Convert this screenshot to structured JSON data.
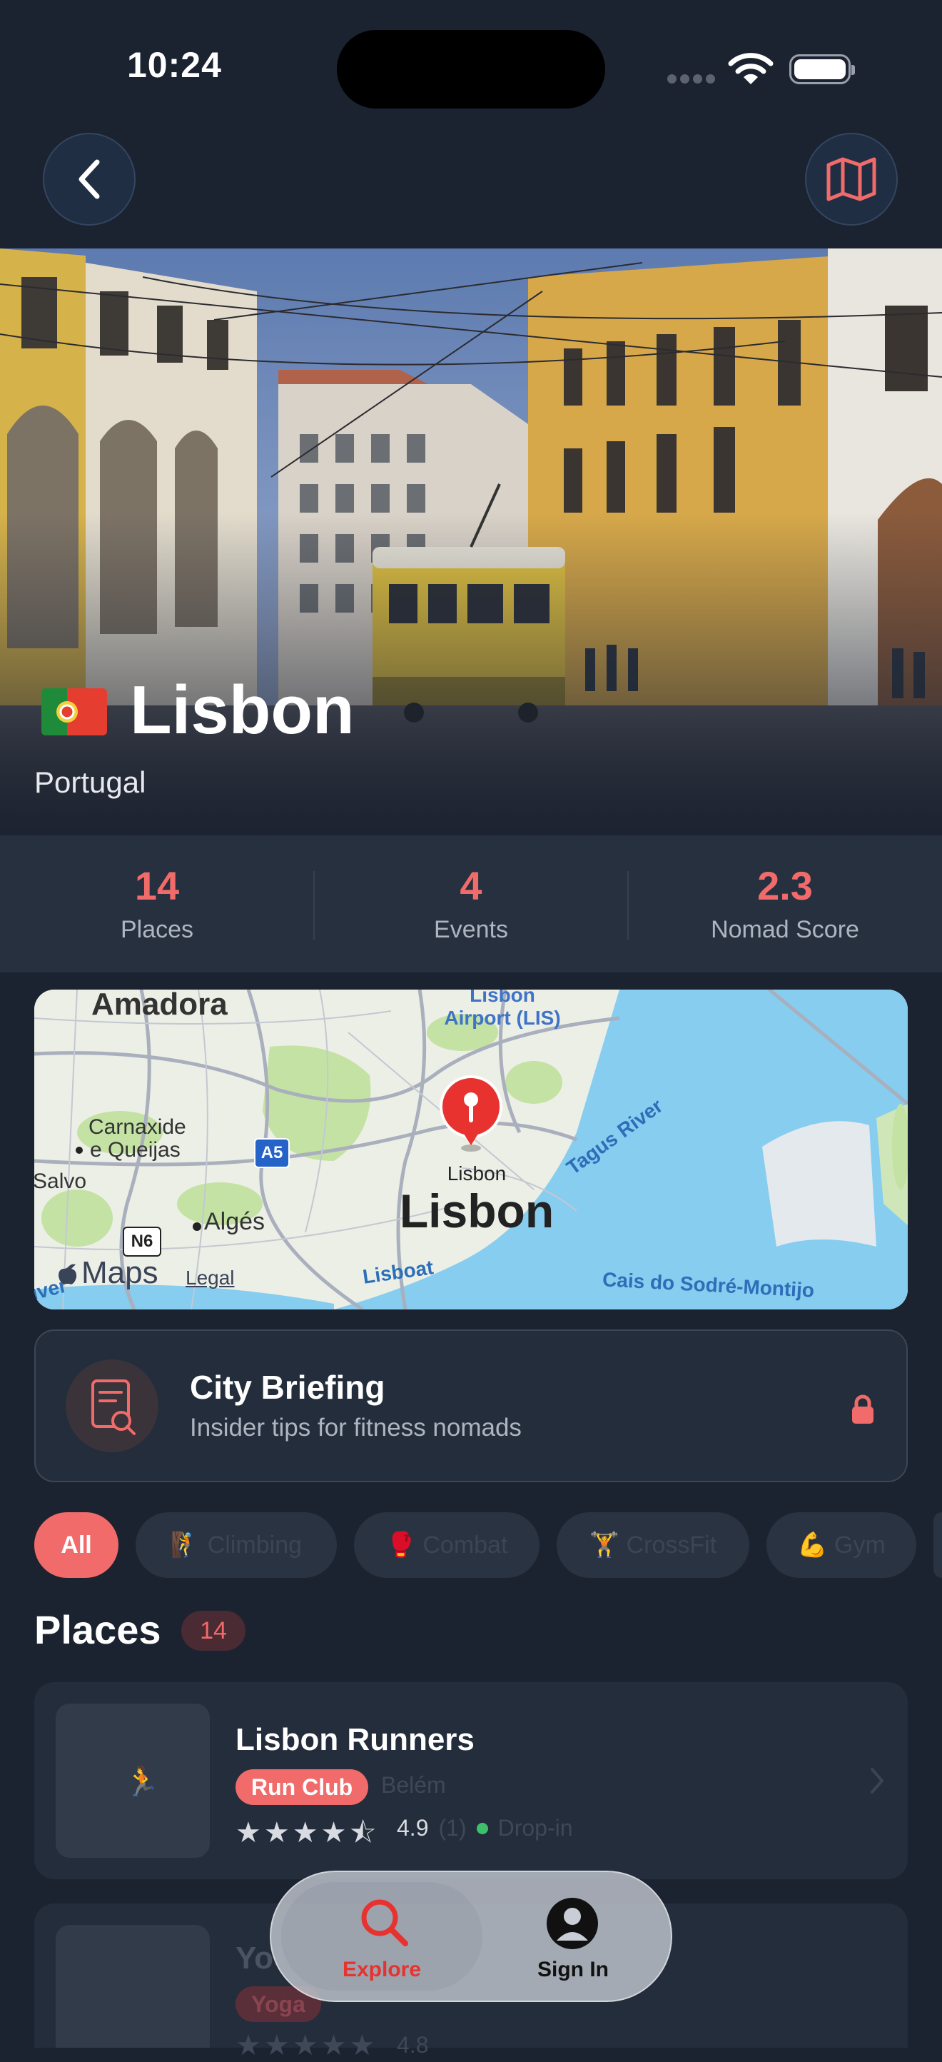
{
  "status_bar": {
    "time": "10:24"
  },
  "hero": {
    "city": "Lisbon",
    "country": "Portugal"
  },
  "stats": [
    {
      "value": "14",
      "label": "Places"
    },
    {
      "value": "4",
      "label": "Events"
    },
    {
      "value": "2.3",
      "label": "Nomad Score"
    }
  ],
  "map": {
    "labels": {
      "amadora": "Amadora",
      "airport": "Lisbon Airport (LIS)",
      "carnaxide": "Carnaxide",
      "queijas": "e Queijas",
      "a5": "A5",
      "salvo": "Salvo",
      "n6": "N6",
      "alges": "Algés",
      "pin_small": "Lisbon",
      "city_big": "Lisbon",
      "tagus": "Tagus River",
      "boat": "Lisboat",
      "cais": "Cais do Sodré-Montijo",
      "river_left": "iver",
      "brand": "Maps",
      "legal": "Legal"
    }
  },
  "briefing": {
    "title": "City Briefing",
    "subtitle": "Insider tips for fitness nomads"
  },
  "filters": [
    {
      "label": "All",
      "active": true
    },
    {
      "label": "🧗 Climbing"
    },
    {
      "label": "🥊 Combat"
    },
    {
      "label": "🏋 CrossFit"
    },
    {
      "label": "💪 Gym"
    }
  ],
  "places": {
    "heading": "Places",
    "count": "14",
    "items": [
      {
        "name": "Lisbon Runners",
        "tag": "Run Club",
        "location": "Belém",
        "stars": "★★★★⯪",
        "rating": "4.9",
        "reviews": "(1)",
        "dropin": "Drop-in"
      },
      {
        "name": "Yo",
        "tag": "Yoga",
        "stars": "★★★★★",
        "rating": "4.8"
      }
    ]
  },
  "tabbar": {
    "explore": "Explore",
    "sign_in": "Sign In"
  },
  "colors": {
    "accent": "#f06b6a",
    "background": "#1b2230",
    "card": "#242d3b"
  }
}
